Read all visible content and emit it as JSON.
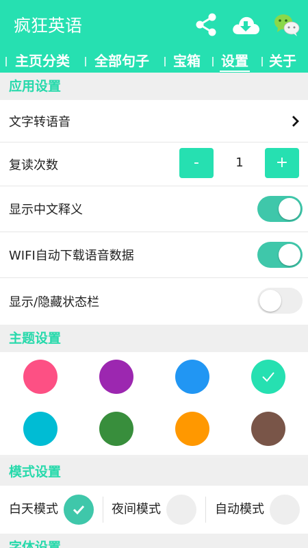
{
  "app": {
    "title": "疯狂英语"
  },
  "header_icons": [
    "share-icon",
    "cloud-download-icon",
    "wechat-icon"
  ],
  "tabs": [
    {
      "label": "主页分类",
      "active": false
    },
    {
      "label": "全部句子",
      "active": false
    },
    {
      "label": "宝箱",
      "active": false
    },
    {
      "label": "设置",
      "active": true
    },
    {
      "label": "关于",
      "active": false
    }
  ],
  "app_settings": {
    "header": "应用设置",
    "tts_label": "文字转语音",
    "repeat_label": "复读次数",
    "repeat_minus": "-",
    "repeat_value": "1",
    "repeat_plus": "+",
    "show_chinese_label": "显示中文释义",
    "show_chinese_on": true,
    "wifi_download_label": "WIFI自动下载语音数据",
    "wifi_download_on": true,
    "statusbar_label": "显示/隐藏状态栏",
    "statusbar_on": false
  },
  "theme": {
    "header": "主题设置",
    "colors": [
      "#fd5084",
      "#9c27b0",
      "#2196f3",
      "#26e0b1",
      "#00bcd4",
      "#388e3c",
      "#ff9800",
      "#795548"
    ],
    "selected_index": 3
  },
  "mode": {
    "header": "模式设置",
    "options": [
      {
        "label": "白天模式",
        "selected": true
      },
      {
        "label": "夜间模式",
        "selected": false
      },
      {
        "label": "自动模式",
        "selected": false
      }
    ]
  },
  "font_settings": {
    "header": "字体设置"
  },
  "colors": {
    "accent": "#26e0b1",
    "switch_on": "#3fc7aa",
    "section_text": "#26d9ab"
  }
}
